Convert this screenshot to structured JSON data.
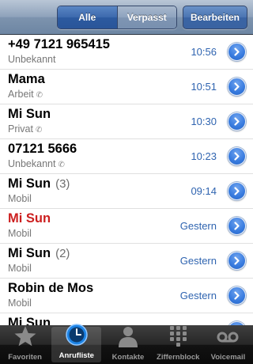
{
  "navbar": {
    "segments": [
      "Alle",
      "Verpasst"
    ],
    "selected_segment": "Alle",
    "edit_label": "Bearbeiten"
  },
  "calls": [
    {
      "name": "+49 7121 965415",
      "count": "",
      "label": "Unbekannt",
      "phone_icon": false,
      "time": "10:56",
      "missed": false
    },
    {
      "name": "Mama",
      "count": "",
      "label": "Arbeit",
      "phone_icon": true,
      "time": "10:51",
      "missed": false
    },
    {
      "name": "Mi Sun",
      "count": "",
      "label": "Privat",
      "phone_icon": true,
      "time": "10:30",
      "missed": false
    },
    {
      "name": "07121 5666",
      "count": "",
      "label": "Unbekannt",
      "phone_icon": true,
      "time": "10:23",
      "missed": false
    },
    {
      "name": "Mi Sun",
      "count": "(3)",
      "label": "Mobil",
      "phone_icon": false,
      "time": "09:14",
      "missed": false
    },
    {
      "name": "Mi Sun",
      "count": "",
      "label": "Mobil",
      "phone_icon": false,
      "time": "Gestern",
      "missed": true
    },
    {
      "name": "Mi Sun",
      "count": "(2)",
      "label": "Mobil",
      "phone_icon": false,
      "time": "Gestern",
      "missed": false
    },
    {
      "name": "Robin de Mos",
      "count": "",
      "label": "Mobil",
      "phone_icon": false,
      "time": "Gestern",
      "missed": false
    },
    {
      "name": "Mi Sun",
      "count": "",
      "label": "",
      "phone_icon": false,
      "time": "",
      "missed": false
    }
  ],
  "tabs": [
    {
      "label": "Favoriten",
      "icon": "star-icon",
      "active": false
    },
    {
      "label": "Anrufliste",
      "icon": "clock-icon",
      "active": true
    },
    {
      "label": "Kontakte",
      "icon": "person-icon",
      "active": false
    },
    {
      "label": "Ziffernblock",
      "icon": "keypad-icon",
      "active": false
    },
    {
      "label": "Voicemail",
      "icon": "voicemail-icon",
      "active": false
    }
  ],
  "colors": {
    "missed_call": "#cc1f1f",
    "time_blue": "#2f64b0",
    "segment_active": "#2c5aa0"
  }
}
